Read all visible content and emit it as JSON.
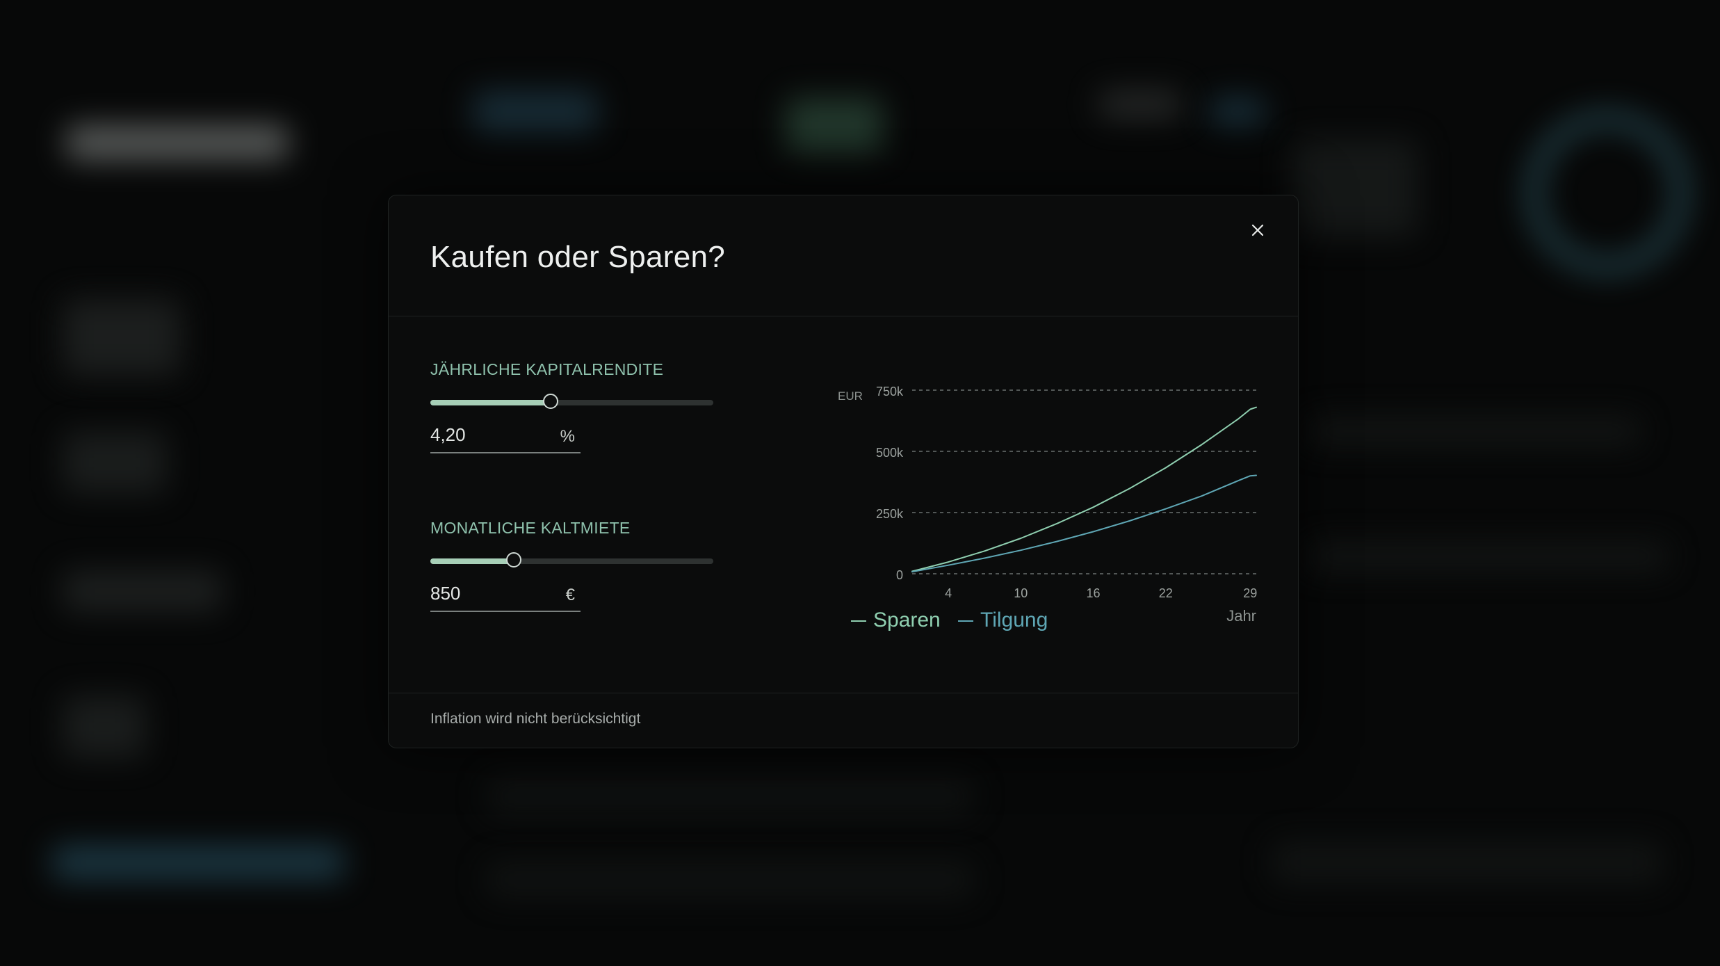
{
  "modal": {
    "title": "Kaufen oder Sparen?",
    "close_icon": "close-icon",
    "footer_note": "Inflation wird nicht berücksichtigt"
  },
  "controls": {
    "return_rate": {
      "label": "JÄHRLICHE KAPITALRENDITE",
      "value": "4,20",
      "unit": "%",
      "slider_fraction": 0.425
    },
    "rent": {
      "label": "MONATLICHE KALTMIETE",
      "value": "850",
      "unit": "€",
      "slider_fraction": 0.295
    }
  },
  "colors": {
    "sparen": "#8fcfb0",
    "tilgung": "#5fa7b5",
    "accent_label": "#8fc2ad",
    "slider_fill": "#a7cfb7"
  },
  "chart_data": {
    "type": "line",
    "y_unit_label": "EUR",
    "xlabel": "Jahr",
    "x_ticks": [
      4,
      10,
      16,
      22,
      29
    ],
    "y_ticks": [
      0,
      250000,
      500000,
      750000
    ],
    "y_tick_labels": [
      "0",
      "250k",
      "500k",
      "750k"
    ],
    "xlim": [
      1,
      29.5
    ],
    "ylim": [
      0,
      750000
    ],
    "grid": "horizontal dashed",
    "legend_placement": "bottom-left",
    "x": [
      1,
      4,
      7,
      10,
      13,
      16,
      19,
      22,
      25,
      28,
      29,
      29.5
    ],
    "series": [
      {
        "name": "Sparen",
        "color_key": "sparen",
        "values": [
          10000,
          48000,
          93000,
          145000,
          205000,
          272000,
          348000,
          433000,
          528000,
          632000,
          672000,
          680000
        ]
      },
      {
        "name": "Tilgung",
        "color_key": "tilgung",
        "values": [
          8000,
          35000,
          64000,
          96000,
          132000,
          172000,
          216000,
          265000,
          318000,
          380000,
          400000,
          402000
        ]
      }
    ]
  }
}
